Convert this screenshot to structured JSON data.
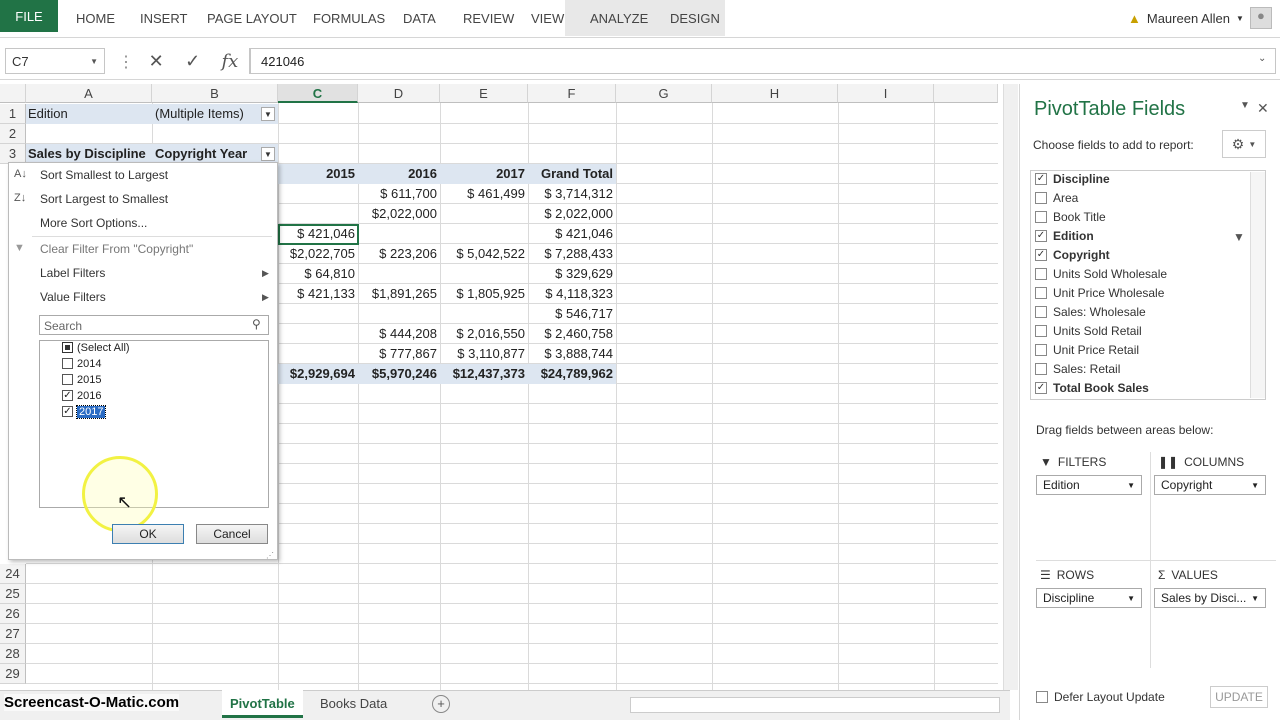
{
  "ribbon": {
    "file": "FILE",
    "tabs": [
      "HOME",
      "INSERT",
      "PAGE LAYOUT",
      "FORMULAS",
      "DATA",
      "REVIEW",
      "VIEW"
    ],
    "context_tabs": [
      "ANALYZE",
      "DESIGN"
    ],
    "user": "Maureen Allen"
  },
  "formula_bar": {
    "name_box": "C7",
    "formula": "421046"
  },
  "columns": [
    "A",
    "B",
    "C",
    "D",
    "E",
    "F",
    "G",
    "H",
    "I"
  ],
  "rows_top": [
    "1",
    "2",
    "3"
  ],
  "rows_bottom": [
    "24",
    "25",
    "26",
    "27",
    "28",
    "29"
  ],
  "pivot": {
    "filter_label": "Edition",
    "filter_value": "(Multiple Items)",
    "values_label": "Sales by Discipline",
    "col_field": "Copyright Year",
    "col_headers": [
      "2015",
      "2016",
      "2017",
      "Grand Total"
    ],
    "data_rows": [
      [
        "",
        "$   611,700",
        "$   461,499",
        "$  3,714,312"
      ],
      [
        "",
        "$2,022,000",
        "",
        "$  2,022,000"
      ],
      [
        "$   421,046",
        "",
        "",
        "$     421,046"
      ],
      [
        "$2,022,705",
        "$   223,206",
        "$  5,042,522",
        "$  7,288,433"
      ],
      [
        "$     64,810",
        "",
        "",
        "$     329,629"
      ],
      [
        "$   421,133",
        "$1,891,265",
        "$  1,805,925",
        "$  4,118,323"
      ],
      [
        "",
        "",
        "",
        "$     546,717"
      ],
      [
        "",
        "$   444,208",
        "$  2,016,550",
        "$  2,460,758"
      ],
      [
        "",
        "$   777,867",
        "$  3,110,877",
        "$  3,888,744"
      ]
    ],
    "grand_total": [
      "$2,929,694",
      "$5,970,246",
      "$12,437,373",
      "$24,789,962"
    ]
  },
  "filter_menu": {
    "sort_asc": "Sort Smallest to Largest",
    "sort_desc": "Sort Largest to Smallest",
    "more_sort": "More Sort Options...",
    "clear_filter": "Clear Filter From \"Copyright\"",
    "label_filters": "Label Filters",
    "value_filters": "Value Filters",
    "search_placeholder": "Search",
    "items": [
      {
        "label": "(Select All)",
        "state": "partial"
      },
      {
        "label": "2014",
        "state": "unchecked"
      },
      {
        "label": "2015",
        "state": "unchecked"
      },
      {
        "label": "2016",
        "state": "checked"
      },
      {
        "label": "2017",
        "state": "checked"
      }
    ],
    "ok": "OK",
    "cancel": "Cancel"
  },
  "pane": {
    "title": "PivotTable Fields",
    "choose": "Choose fields to add to report:",
    "fields": [
      {
        "label": "Discipline",
        "checked": true
      },
      {
        "label": "Area",
        "checked": false
      },
      {
        "label": "Book Title",
        "checked": false
      },
      {
        "label": "Edition",
        "checked": true
      },
      {
        "label": "Copyright",
        "checked": true
      },
      {
        "label": "Units Sold Wholesale",
        "checked": false
      },
      {
        "label": "Unit Price Wholesale",
        "checked": false
      },
      {
        "label": "Sales: Wholesale",
        "checked": false
      },
      {
        "label": "Units Sold Retail",
        "checked": false
      },
      {
        "label": "Unit Price Retail",
        "checked": false
      },
      {
        "label": "Sales: Retail",
        "checked": false
      },
      {
        "label": "Total Book Sales",
        "checked": true
      }
    ],
    "drag_label": "Drag fields between areas below:",
    "filters_label": "FILTERS",
    "columns_label": "COLUMNS",
    "rows_label": "ROWS",
    "values_label": "VALUES",
    "filters_value": "Edition",
    "columns_value": "Copyright",
    "rows_value": "Discipline",
    "values_value": "Sales by Disci...",
    "defer": "Defer Layout Update",
    "update": "UPDATE"
  },
  "sheet_tabs": {
    "active": "PivotTable",
    "other": "Books Data"
  },
  "watermark": "Screencast-O-Matic.com",
  "colors": {
    "accent": "#217346",
    "pivot_band": "#dde6f1",
    "highlight": "#f2f243"
  }
}
